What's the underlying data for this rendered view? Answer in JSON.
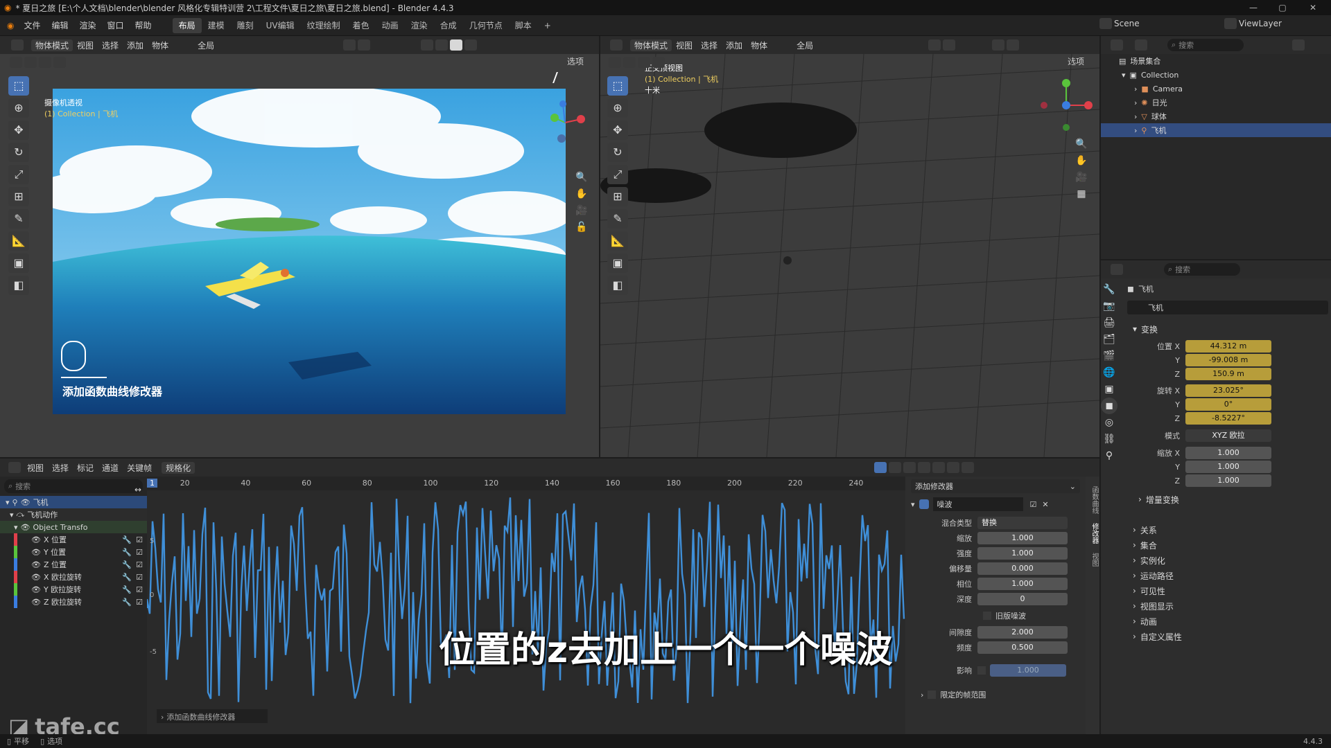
{
  "window": {
    "title": "* 夏日之旅 [E:\\个人文档\\blender\\blender 风格化专辑特训营 2\\工程文件\\夏日之旅\\夏日之旅.blend] - Blender 4.4.3"
  },
  "menu": {
    "items": [
      "文件",
      "编辑",
      "渲染",
      "窗口",
      "帮助"
    ]
  },
  "workspaces": [
    "布局",
    "建模",
    "雕刻",
    "UV编辑",
    "纹理绘制",
    "着色",
    "动画",
    "渲染",
    "合成",
    "几何节点",
    "脚本"
  ],
  "scene": {
    "name": "Scene",
    "view_layer": "ViewLayer"
  },
  "viewport_left": {
    "mode": "物体模式",
    "menus": [
      "视图",
      "选择",
      "添加",
      "物体"
    ],
    "transform": "全局",
    "options": "选项",
    "label1": "摄像机透视",
    "label2": "(1) Collection | 飞机",
    "status_text": "添加函数曲线修改器"
  },
  "viewport_right": {
    "mode": "物体模式",
    "menus": [
      "视图",
      "选择",
      "添加",
      "物体"
    ],
    "transform": "全局",
    "options": "选项",
    "label1": "正交顶视图",
    "label2": "(1) Collection | 飞机",
    "label3": "十米"
  },
  "graph_editor": {
    "menus": [
      "视图",
      "选择",
      "标记",
      "通道",
      "关键帧"
    ],
    "normalize": "规格化",
    "search_placeholder": "搜索",
    "ruler": [
      "1",
      "20",
      "40",
      "60",
      "80",
      "100",
      "120",
      "140",
      "160",
      "180",
      "200",
      "220",
      "240"
    ],
    "yticks": [
      "5",
      "0",
      "-5"
    ],
    "channels": {
      "object": "飞机",
      "action": "飞机动作",
      "group": "Object Transfo",
      "items": [
        "X 位置",
        "Y 位置",
        "Z 位置",
        "X 欧拉旋转",
        "Y 欧拉旋转",
        "Z 欧拉旋转"
      ],
      "colors": [
        "#e0404a",
        "#5ac43c",
        "#3a7de0",
        "#e0404a",
        "#5ac43c",
        "#3a7de0"
      ]
    },
    "collapsed_panel": "添加函数曲线修改器",
    "curve_color": "#3f8fd8"
  },
  "modifier": {
    "add": "添加修改器",
    "name": "噪波",
    "fields": [
      {
        "label": "混合类型",
        "value": "替换"
      },
      {
        "label": "缩放",
        "value": "1.000"
      },
      {
        "label": "强度",
        "value": "1.000"
      },
      {
        "label": "偏移量",
        "value": "0.000"
      },
      {
        "label": "相位",
        "value": "1.000"
      },
      {
        "label": "深度",
        "value": "0"
      }
    ],
    "legacy": "旧版噪波",
    "fields2": [
      {
        "label": "间隙度",
        "value": "2.000"
      },
      {
        "label": "频度",
        "value": "0.500"
      }
    ],
    "influence_label": "影响",
    "influence_value": "1.000",
    "restrict": "限定的帧范围",
    "side_tabs": [
      "函数曲线",
      "修改器",
      "视图"
    ]
  },
  "outliner": {
    "search": "搜索",
    "root": "场景集合",
    "collection": "Collection",
    "objects": [
      "Camera",
      "日光",
      "球体",
      "飞机"
    ]
  },
  "properties": {
    "search": "搜索",
    "object": "飞机",
    "datablock": "飞机",
    "transform_title": "变换",
    "loc_label": "位置 X",
    "loc": [
      "44.312 m",
      "-99.008 m",
      "150.9 m"
    ],
    "rot_label": "旋转 X",
    "rot": [
      "23.025°",
      "0°",
      "-8.5227°"
    ],
    "mode_label": "模式",
    "mode": "XYZ 欧拉",
    "scale_label": "缩放 X",
    "scale": [
      "1.000",
      "1.000",
      "1.000"
    ],
    "delta": "增量变换",
    "axis_y": "Y",
    "axis_z": "Z",
    "sections": [
      "关系",
      "集合",
      "实例化",
      "运动路径",
      "可见性",
      "视图显示",
      "动画",
      "自定义属性"
    ]
  },
  "subtitle": "位置的z去加上一个一个噪波",
  "watermark": "tafe.cc",
  "statusbar": {
    "left1": "平移",
    "left2": "选项",
    "version": "4.4.3"
  }
}
